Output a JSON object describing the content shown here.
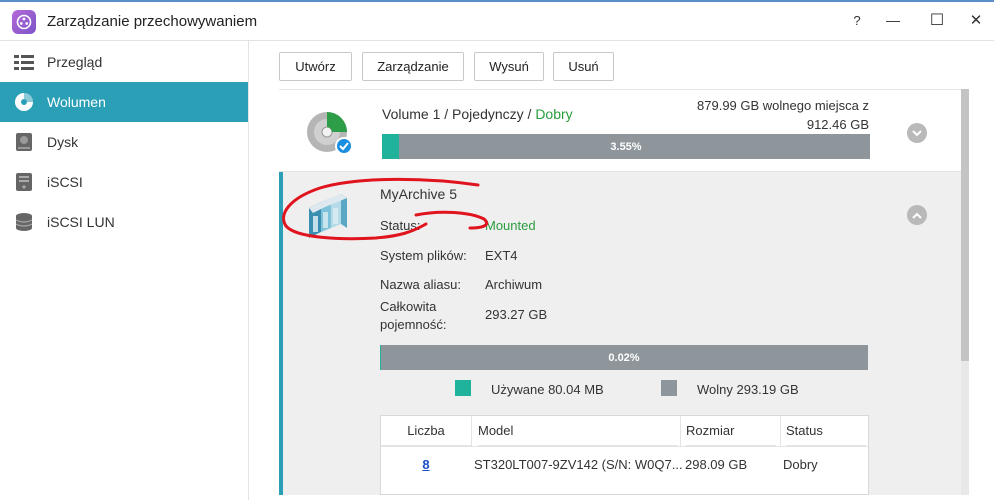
{
  "window": {
    "title": "Zarządzanie przechowywaniem",
    "help_label": "?",
    "minimize_label": "—",
    "maximize_label": "☐",
    "close_label": "✕"
  },
  "sidebar": {
    "items": [
      {
        "label": "Przegląd",
        "icon": "overview-icon",
        "active": false
      },
      {
        "label": "Wolumen",
        "icon": "volume-icon",
        "active": true
      },
      {
        "label": "Dysk",
        "icon": "disk-icon",
        "active": false
      },
      {
        "label": "iSCSI",
        "icon": "iscsi-icon",
        "active": false
      },
      {
        "label": "iSCSI LUN",
        "icon": "iscsi-lun-icon",
        "active": false
      }
    ]
  },
  "toolbar": {
    "create_label": "Utwórz",
    "manage_label": "Zarządzanie",
    "eject_label": "Wysuń",
    "delete_label": "Usuń"
  },
  "volume1": {
    "name": "Volume 1",
    "type": "Pojedynczy",
    "status": "Dobry",
    "sep": " / ",
    "free_line1": "879.99 GB wolnego miejsca z",
    "free_line2": "912.46 GB",
    "usage_percent": 3.55,
    "usage_label": "3.55%"
  },
  "archive": {
    "name": "MyArchive 5",
    "status_label": "Status:",
    "status_value": "Mounted",
    "fs_label": "System plików:",
    "fs_value": "EXT4",
    "alias_label": "Nazwa aliasu:",
    "alias_value": "Archiwum",
    "capacity_label_1": "Całkowita",
    "capacity_label_2": "pojemność:",
    "capacity_value": "293.27 GB",
    "usage_percent": 0.02,
    "usage_label": "0.02%",
    "used_legend": "Używane 80.04 MB",
    "free_legend": "Wolny 293.19 GB"
  },
  "disk_table": {
    "headers": [
      "Liczba",
      "Model",
      "Rozmiar",
      "Status"
    ],
    "rows": [
      {
        "number": "8",
        "model": "ST320LT007-9ZV142 (S/N: W0Q7...",
        "size": "298.09 GB",
        "status": "Dobry"
      }
    ]
  },
  "colors": {
    "accent": "#2b9fb6",
    "used": "#1fb39b",
    "free": "#8e969b",
    "good": "#2a9d3e",
    "annotation": "#e0141e"
  }
}
